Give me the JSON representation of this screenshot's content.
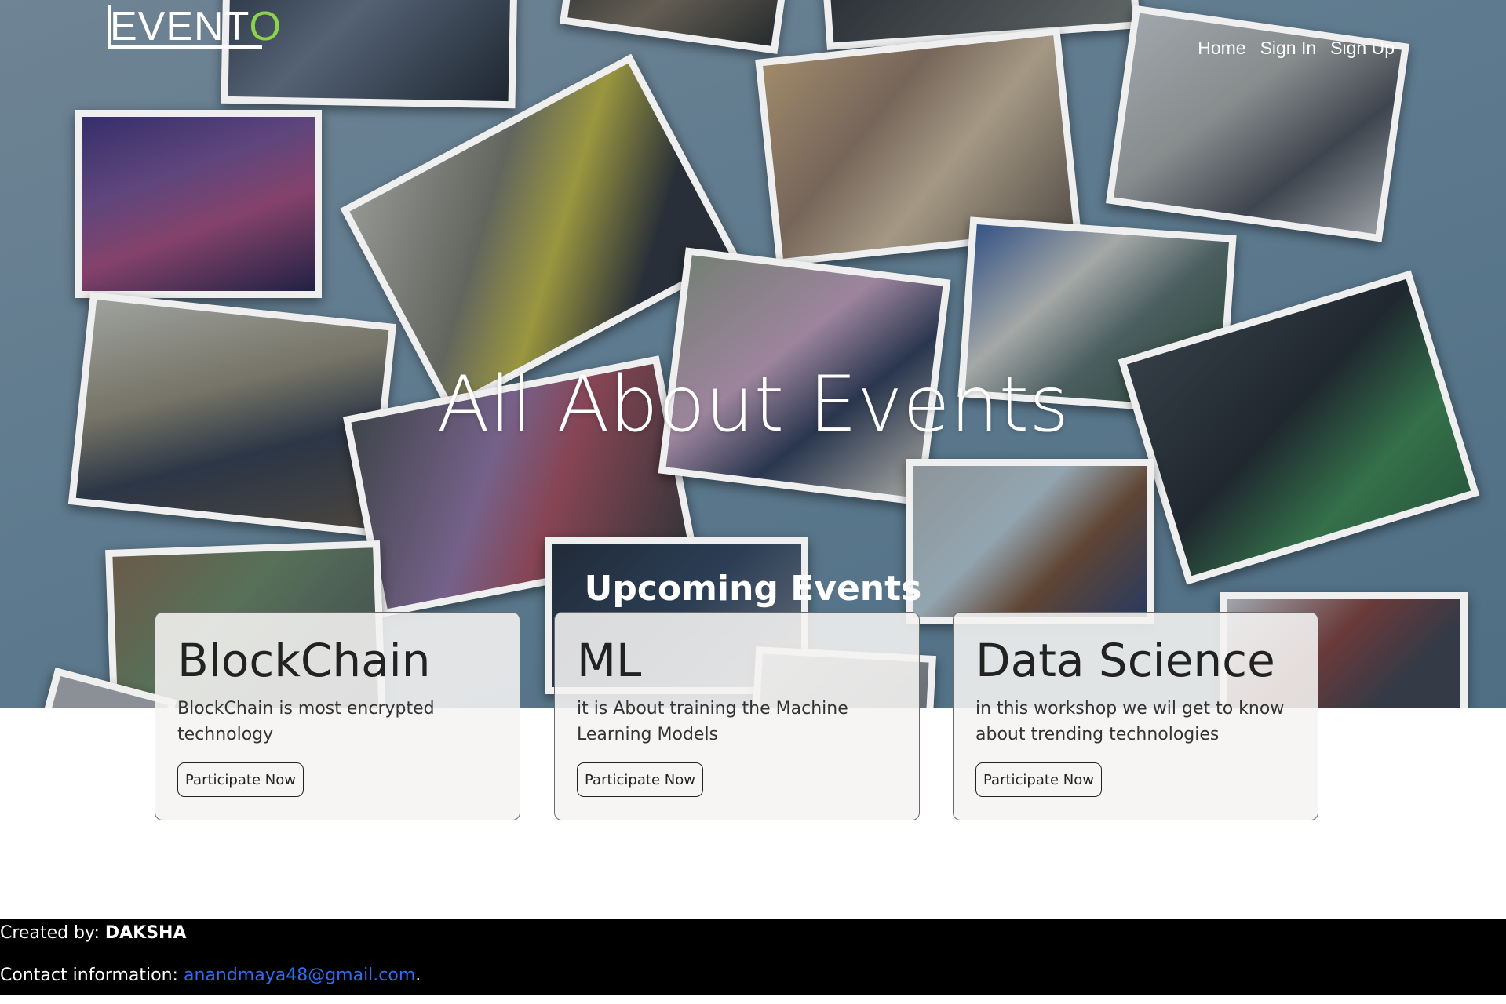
{
  "brand": {
    "logo_text": "EVENT",
    "logo_last_letter": "O",
    "logo_accent": "#8cd24a"
  },
  "nav": {
    "home": "Home",
    "sign_in": "Sign In",
    "sign_up": "Sign Up"
  },
  "hero": {
    "title": "All About Events"
  },
  "upcoming": {
    "title": "Upcoming Events",
    "cards": [
      {
        "title": "BlockChain",
        "description": "BlockChain is most encrypted technology",
        "button": "Participate Now"
      },
      {
        "title": "ML",
        "description": "it is About training the Machine Learning Models",
        "button": "Participate Now"
      },
      {
        "title": "Data Science",
        "description": "in this workshop we wil get to know about trending technologies",
        "button": "Participate Now"
      }
    ]
  },
  "footer": {
    "created_label": "Created by: ",
    "author": "DAKSHA",
    "contact_label": "Contact information: ",
    "email": "anandmaya48@gmail.com",
    "period": "."
  }
}
